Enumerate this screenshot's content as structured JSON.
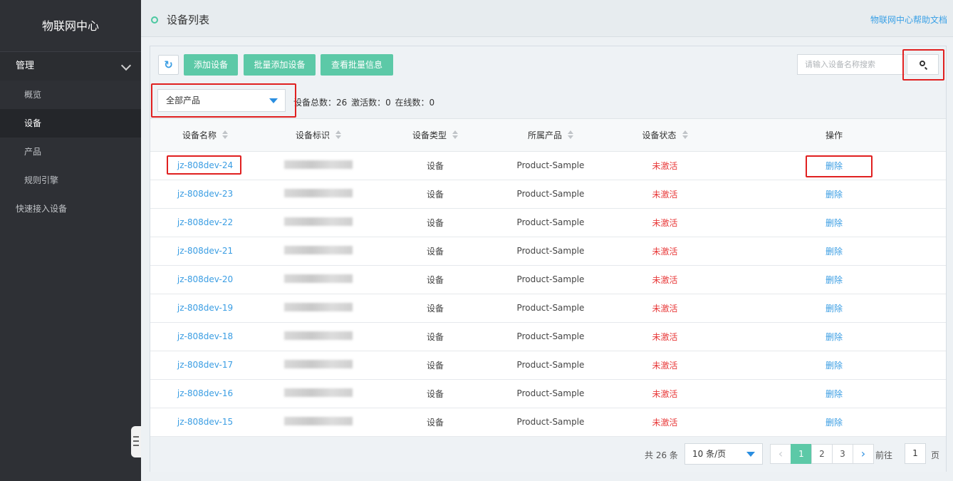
{
  "sidebar": {
    "brand": "物联网中心",
    "group_label": "管理",
    "items": [
      {
        "label": "概览"
      },
      {
        "label": "设备"
      },
      {
        "label": "产品"
      },
      {
        "label": "规则引擎"
      }
    ],
    "quick_access": "快速接入设备"
  },
  "header": {
    "title": "设备列表",
    "help_link": "物联网中心帮助文档"
  },
  "toolbar": {
    "refresh_icon": "refresh-icon",
    "add_device": "添加设备",
    "batch_add": "批量添加设备",
    "view_batch": "查看批量信息",
    "search_placeholder": "请输入设备名称搜索",
    "search_icon": "search-icon"
  },
  "filter": {
    "product_select": "全部产品",
    "stats": "设备总数：26   激活数：0   在线数：0"
  },
  "table": {
    "columns": [
      "设备名称",
      "设备标识",
      "设备类型",
      "所属产品",
      "设备状态",
      "操作"
    ],
    "rows": [
      {
        "name": "jz-808dev-24",
        "type": "设备",
        "product": "Product-Sample",
        "status": "未激活",
        "action": "删除"
      },
      {
        "name": "jz-808dev-23",
        "type": "设备",
        "product": "Product-Sample",
        "status": "未激活",
        "action": "删除"
      },
      {
        "name": "jz-808dev-22",
        "type": "设备",
        "product": "Product-Sample",
        "status": "未激活",
        "action": "删除"
      },
      {
        "name": "jz-808dev-21",
        "type": "设备",
        "product": "Product-Sample",
        "status": "未激活",
        "action": "删除"
      },
      {
        "name": "jz-808dev-20",
        "type": "设备",
        "product": "Product-Sample",
        "status": "未激活",
        "action": "删除"
      },
      {
        "name": "jz-808dev-19",
        "type": "设备",
        "product": "Product-Sample",
        "status": "未激活",
        "action": "删除"
      },
      {
        "name": "jz-808dev-18",
        "type": "设备",
        "product": "Product-Sample",
        "status": "未激活",
        "action": "删除"
      },
      {
        "name": "jz-808dev-17",
        "type": "设备",
        "product": "Product-Sample",
        "status": "未激活",
        "action": "删除"
      },
      {
        "name": "jz-808dev-16",
        "type": "设备",
        "product": "Product-Sample",
        "status": "未激活",
        "action": "删除"
      },
      {
        "name": "jz-808dev-15",
        "type": "设备",
        "product": "Product-Sample",
        "status": "未激活",
        "action": "删除"
      }
    ]
  },
  "pagination": {
    "total": "共 26 条",
    "page_size": "10 条/页",
    "pages": [
      "1",
      "2",
      "3"
    ],
    "current_page": "1",
    "goto_label": "前往",
    "goto_value": "1",
    "goto_suffix": "页"
  },
  "colors": {
    "accent_green": "#5cc9a7",
    "link_blue": "#3a9de3",
    "status_red": "#e83a3a",
    "annotation_red": "#e02020"
  }
}
